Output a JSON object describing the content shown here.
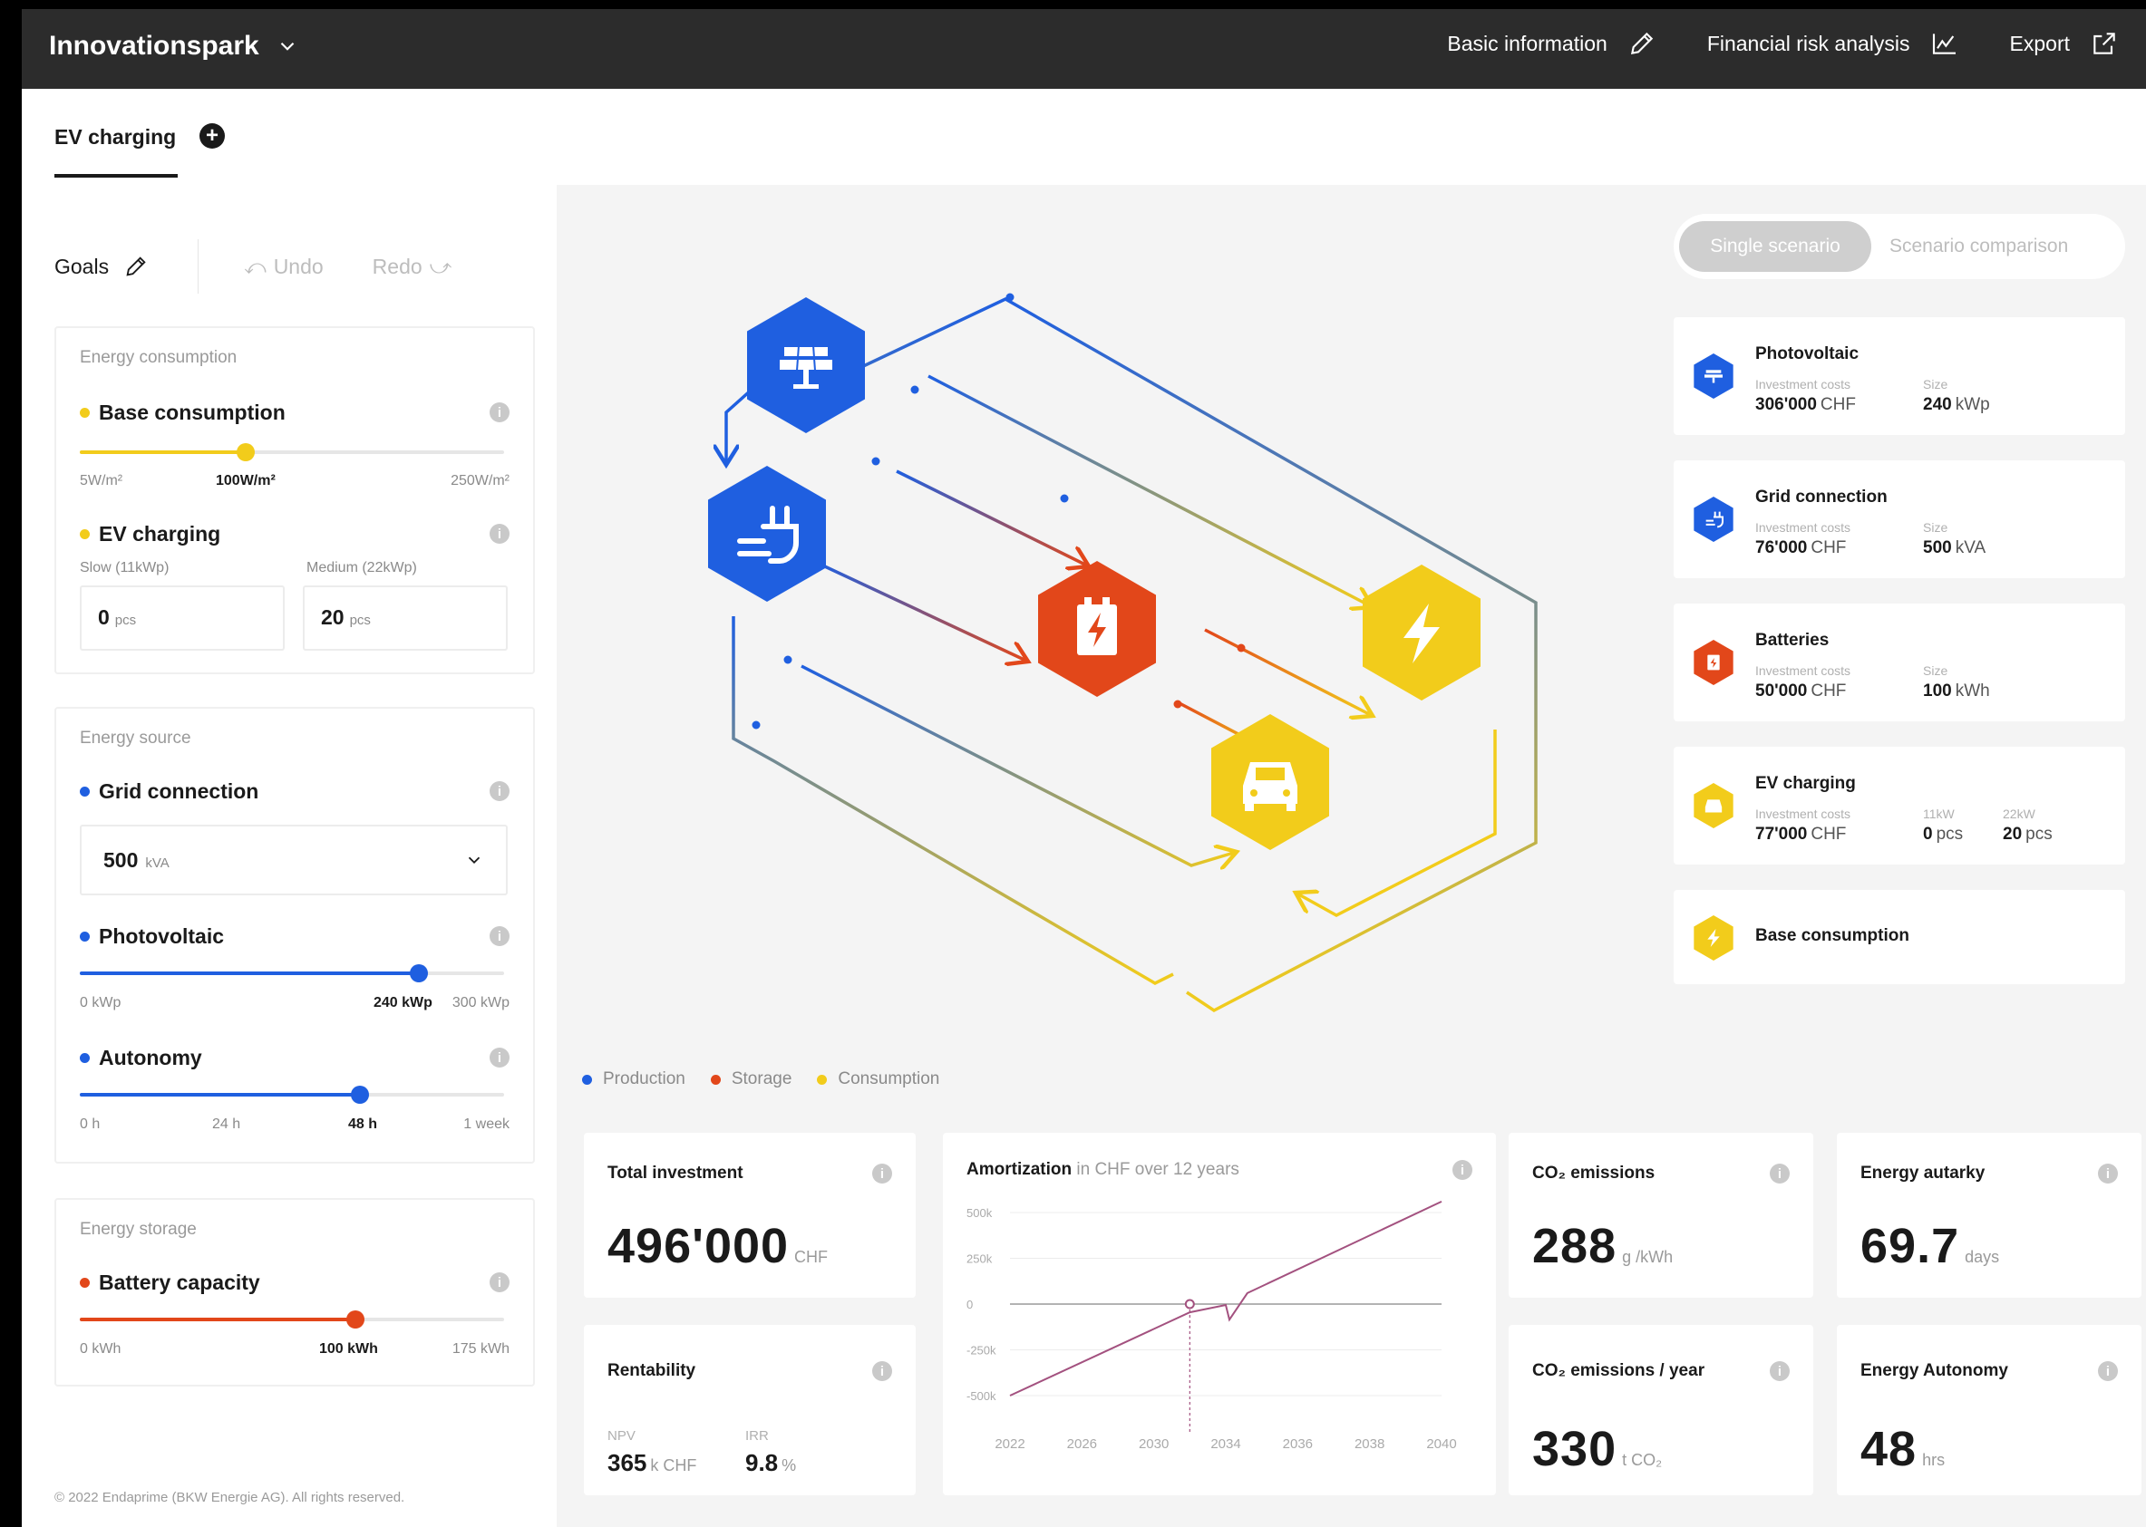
{
  "header": {
    "project": "Innovationspark",
    "nav": [
      "Basic information",
      "Financial risk analysis",
      "Export"
    ]
  },
  "tabs": {
    "active": "EV charging",
    "add": "+"
  },
  "toolbar": {
    "goals": "Goals",
    "undo": "Undo",
    "redo": "Redo"
  },
  "consumption": {
    "title": "Energy consumption",
    "base": {
      "label": "Base consumption",
      "min": "5W/m²",
      "value": "100W/m²",
      "max": "250W/m²",
      "fraction": 0.39
    },
    "ev": {
      "label": "EV charging",
      "slow_label": "Slow (11kWp)",
      "medium_label": "Medium (22kWp)",
      "slow_value": "0",
      "medium_value": "20",
      "unit": "pcs"
    }
  },
  "source": {
    "title": "Energy source",
    "grid": {
      "label": "Grid connection",
      "value": "500",
      "unit": "kVA"
    },
    "pv": {
      "label": "Photovoltaic",
      "min": "0 kWp",
      "value": "240 kWp",
      "max": "300 kWp",
      "fraction": 0.8
    },
    "autonomy": {
      "label": "Autonomy",
      "ticks": [
        "0 h",
        "24 h",
        "48 h",
        "1 week"
      ],
      "fraction": 0.66
    }
  },
  "storage": {
    "title": "Energy storage",
    "battery": {
      "label": "Battery capacity",
      "min": "0 kWh",
      "value": "100 kWh",
      "max": "175 kWh",
      "fraction": 0.65
    }
  },
  "copyright": "© 2022 Endaprime (BKW Energie AG). All rights reserved.",
  "scenario": {
    "single": "Single scenario",
    "comparison": "Scenario comparison"
  },
  "legend": [
    "Production",
    "Storage",
    "Consumption"
  ],
  "components": [
    {
      "name": "Photovoltaic",
      "k1": "Investment costs",
      "v1": "306'000",
      "u1": "CHF",
      "k2": "Size",
      "v2": "240",
      "u2": "kWp"
    },
    {
      "name": "Grid connection",
      "k1": "Investment costs",
      "v1": "76'000",
      "u1": "CHF",
      "k2": "Size",
      "v2": "500",
      "u2": "kVA"
    },
    {
      "name": "Batteries",
      "k1": "Investment costs",
      "v1": "50'000",
      "u1": "CHF",
      "k2": "Size",
      "v2": "100",
      "u2": "kWh"
    },
    {
      "name": "EV charging",
      "k1": "Investment costs",
      "v1": "77'000",
      "u1": "CHF",
      "k2": "11kW",
      "v2": "0",
      "u2": "pcs",
      "k3": "22kW",
      "v3": "20",
      "u3": "pcs"
    },
    {
      "name": "Base consumption"
    }
  ],
  "kpis": {
    "total_investment": {
      "title": "Total investment",
      "value": "496'000",
      "unit": "CHF"
    },
    "rentability": {
      "title": "Rentability",
      "npv_label": "NPV",
      "npv_value": "365",
      "npv_unit": "k CHF",
      "irr_label": "IRR",
      "irr_value": "9.8",
      "irr_unit": "%"
    },
    "co2": {
      "title": "CO₂ emissions",
      "value": "288",
      "unit": "g /kWh"
    },
    "co2_year": {
      "title": "CO₂ emissions / year",
      "value": "330",
      "unit": "t CO₂"
    },
    "autarky": {
      "title": "Energy autarky",
      "value": "69.7",
      "unit": "days"
    },
    "autonomy": {
      "title": "Energy Autonomy",
      "value": "48",
      "unit": "hrs"
    }
  },
  "amortization": {
    "title": "Amortization",
    "subtitle": "in CHF over 12 years"
  },
  "colors": {
    "production": "#1f5fe0",
    "storage": "#e2471a",
    "consumption": "#f2cc1b",
    "amortization": "#a3517f"
  },
  "chart_data": {
    "type": "line",
    "ytick_labels": [
      "500k",
      "250k",
      "0",
      "-250k",
      "-500k"
    ],
    "yticks": [
      500000,
      250000,
      0,
      -250000,
      -500000
    ],
    "ylim": [
      -500000,
      500000
    ],
    "x_labels": [
      "2022",
      "2026",
      "2030",
      "2034",
      "2036",
      "2038",
      "2040"
    ],
    "series": [
      {
        "points": [
          [
            0,
            -500000
          ],
          [
            2.5,
            -45000
          ],
          [
            3.0,
            -5000
          ],
          [
            3.05,
            -85000
          ],
          [
            3.3,
            60000
          ],
          [
            6.0,
            560000
          ]
        ]
      }
    ],
    "break_even_x": 2.5,
    "grid": true
  }
}
